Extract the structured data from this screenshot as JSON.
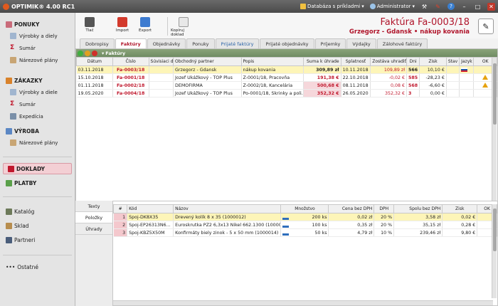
{
  "titlebar": {
    "app": "OPTIMIK® 4.00 RC1",
    "db": "Databáza s príkladmi",
    "user": "Administrator"
  },
  "sidebar": {
    "sections": [
      {
        "head": "PONUKY",
        "items": [
          "Výrobky a diely",
          "Sumár",
          "Nárezové plány"
        ]
      },
      {
        "head": "ZÁKAZKY",
        "items": [
          "Výrobky a diele",
          "Sumár",
          "Expedícia"
        ]
      },
      {
        "head": "VÝROBA",
        "items": [
          "Nárezové plány"
        ]
      }
    ],
    "doklady": "DOKLADY",
    "platby": "PLATBY",
    "bottom": [
      "Katalóg",
      "Sklad",
      "Partneri"
    ],
    "ostatne": "Ostatné"
  },
  "toolbar": {
    "tlac": "Tlač",
    "import": "Import",
    "export": "Export",
    "kopiruj": "Kopíruj doklad"
  },
  "title": {
    "main": "Faktúra Fa-0003/18",
    "sub": "Grzegorz - Gdansk  •  nákup kovania"
  },
  "tabs": [
    "Dobropisy",
    "Faktúry",
    "Objednávky",
    "Ponuky",
    "Prijaté faktúry",
    "Prijaté objednávky",
    "Príjemky",
    "Výdajky",
    "Zálohové faktúry"
  ],
  "grid": {
    "label": "Faktúry",
    "columns": [
      "Dátum",
      "Číslo",
      "Súvisiaci d...",
      "Obchodný partner",
      "Popis",
      "Suma k úhrade",
      "Splatnosť",
      "Zostáva uhradiť",
      "Dni",
      "Zisk",
      "Stav",
      "Jazyk",
      "OK"
    ],
    "rows": [
      {
        "datum": "03.11.2018",
        "cislo": "Fa-0003/18",
        "suv": "",
        "partner": "Grzegorz - Gdansk",
        "popis": "nákup kovania",
        "suma": "309,89 zł",
        "splat": "10.11.2018",
        "zostava": "109,89 zł",
        "dni": "566",
        "zisk": "10,10 €"
      },
      {
        "datum": "15.10.2018",
        "cislo": "Fa-0001/18",
        "suv": "",
        "partner": "Jozef Ukážkový - TOP Plus",
        "popis": "Z-0001/18, Pracovňa",
        "suma": "191,38 €",
        "splat": "22.10.2018",
        "zostava": "-0,02 €",
        "dni": "585",
        "zisk": "-28,23 €"
      },
      {
        "datum": "01.11.2018",
        "cislo": "Fa-0002/18",
        "suv": "",
        "partner": "DEMOFIRMA",
        "popis": "Z-0002/18, Kancelária",
        "suma": "500,68 €",
        "splat": "08.11.2018",
        "zostava": "0,08 €",
        "dni": "568",
        "zisk": "-6,60 €"
      },
      {
        "datum": "19.05.2020",
        "cislo": "Fa-0004/18",
        "suv": "",
        "partner": "Jozef Ukážkový - TOP Plus",
        "popis": "Po-0001/18, Skrinky a poli...",
        "suma": "352,32 €",
        "splat": "26.05.2020",
        "zostava": "352,32 €",
        "dni": "3",
        "zisk": "0,00 €"
      }
    ]
  },
  "ltabs": [
    "Texty",
    "Položky",
    "Úhrady"
  ],
  "items": {
    "columns": [
      "#",
      "Kód",
      "Názov",
      "Množstvo",
      "Cena bez DPH",
      "DPH",
      "Spolu bez DPH",
      "Zisk",
      "OK"
    ],
    "rows": [
      {
        "n": "1",
        "kod": "Spoj-DK8X35",
        "nazov": "Drevený kolík 8 x 35  (1000012)",
        "mn": "200 ks",
        "cena": "0,02 zł",
        "dph": "20 %",
        "spolu": "3,58 zł",
        "zisk": "0,02 €"
      },
      {
        "n": "2",
        "kod": "Spoj-EP26313N6...",
        "nazov": "Euroskrutka PZ2 6,3x13 Nikel 662.1300  (1000023)",
        "mn": "100 ks",
        "cena": "0,35 zł",
        "dph": "20 %",
        "spolu": "35,15 zł",
        "zisk": "0,28 €"
      },
      {
        "n": "3",
        "kod": "Spoj-KBZ5X50M",
        "nazov": "Konfirmáty biely zinok - 5 x 50 mm  (1000014)",
        "mn": "50 ks",
        "cena": "4,79 zł",
        "dph": "10 %",
        "spolu": "239,46 zł",
        "zisk": "9,80 €"
      }
    ]
  }
}
